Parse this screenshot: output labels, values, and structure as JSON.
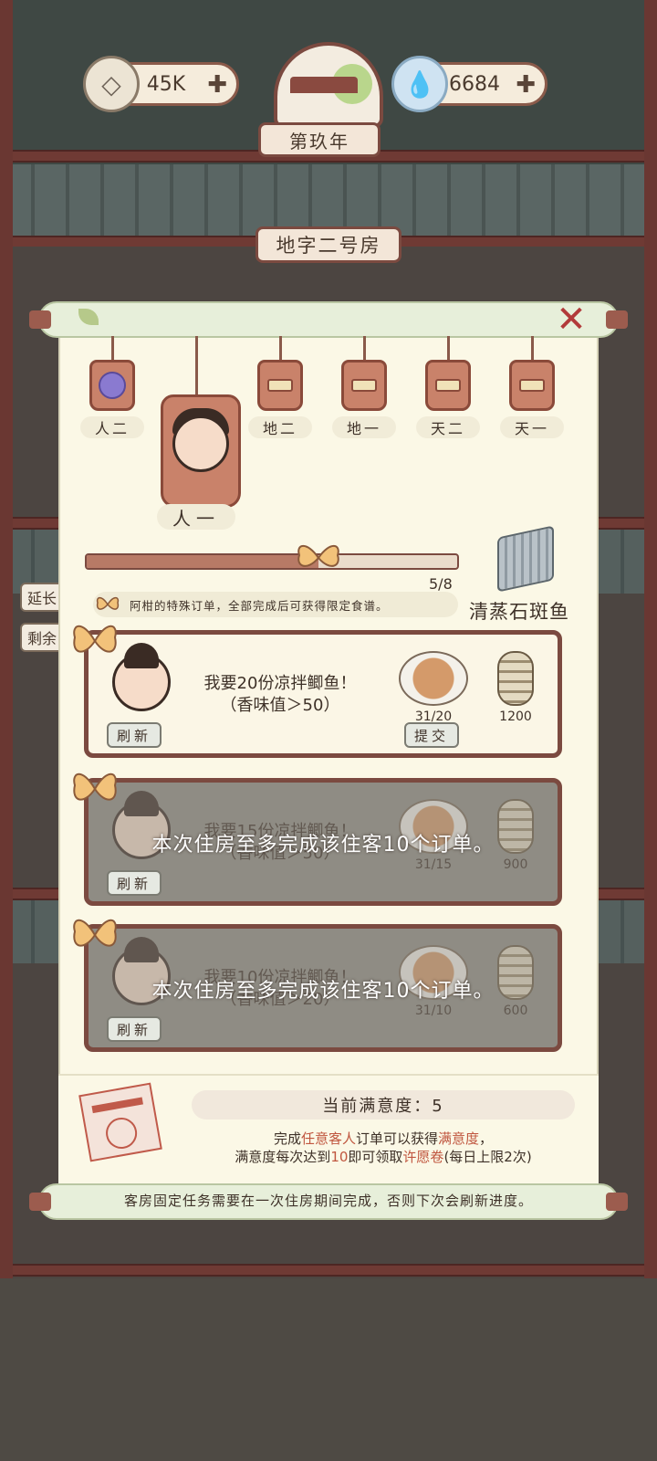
{
  "hud": {
    "coins": "45K",
    "gems": "6684",
    "plus": "✚",
    "year": "第玖年"
  },
  "room": {
    "title": "地字二号房"
  },
  "side_labels": [
    "延长",
    "剩余"
  ],
  "guests": [
    {
      "label": "人二",
      "icon": "fruit-icon"
    },
    {
      "label": "人一",
      "icon": "guest-face-icon",
      "selected": true
    },
    {
      "label": "地二",
      "icon": "empty-slot-icon"
    },
    {
      "label": "地一",
      "icon": "empty-slot-icon"
    },
    {
      "label": "天二",
      "icon": "empty-slot-icon"
    },
    {
      "label": "天一",
      "icon": "empty-slot-icon"
    }
  ],
  "special": {
    "progress_text": "5/8",
    "progress_fraction": 0.625,
    "note": "阿柑的特殊订单，全部完成后可获得限定食谱。",
    "reward_name": "清蒸石斑鱼"
  },
  "orders": [
    {
      "request_line1": "我要20份凉拌鲫鱼！",
      "request_line2": "（香味值＞50）",
      "progress": "31/20",
      "reward": "1200",
      "refresh": "刷新",
      "submit": "提交",
      "locked": false
    },
    {
      "request_line1": "我要15份凉拌鲫鱼！",
      "request_line2": "（香味值＞50）",
      "progress": "31/15",
      "reward": "900",
      "refresh": "刷新",
      "locked": true,
      "lock_msg": "本次住房至多完成该住客10个订单。"
    },
    {
      "request_line1": "我要10份凉拌鲫鱼！",
      "request_line2": "（香味值＞20）",
      "progress": "31/10",
      "reward": "600",
      "refresh": "刷新",
      "locked": true,
      "lock_msg": "本次住房至多完成该住客10个订单。"
    }
  ],
  "satisfaction": {
    "title": "当前满意度：5",
    "line1_a": "完成",
    "line1_b": "任意客人",
    "line1_c": "订单可以获得",
    "line1_d": "满意度",
    "line1_e": "，",
    "line2_a": "满意度每次达到",
    "line2_b": "10",
    "line2_c": "即可领取",
    "line2_d": "许愿卷",
    "line2_e": "(每日上限2次)"
  },
  "footer_note": "客房固定任务需要在一次住房期间完成，否则下次会刷新进度。",
  "close": "✕",
  "colors": {
    "accent": "#7b4a40",
    "highlight": "#c0563f",
    "panel": "#fbf8e6"
  }
}
